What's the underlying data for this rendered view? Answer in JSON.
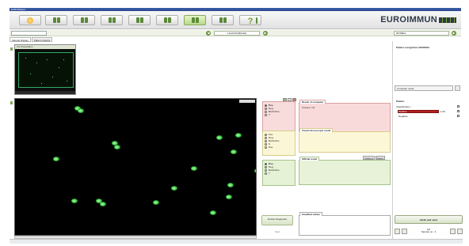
{
  "window": {
    "title": "EUROPattern"
  },
  "toolbar": {
    "brand": "EUROIMMUN"
  },
  "navbar": {
    "sample_id": "13/AFSPCBFADH",
    "right_sample": "0876B0A"
  },
  "tabs": [
    {
      "label": "Sample Display"
    },
    {
      "label": "Pattern Graphs"
    }
  ],
  "overview": {
    "title": "Vis Preparation"
  },
  "image": {
    "zoom": ""
  },
  "options": {
    "computer": [
      "Pos.",
      "Neg.",
      "Borderline",
      "?"
    ],
    "visual": [
      "Pos.",
      "Neg.",
      "Borderline",
      "N",
      "Pos."
    ],
    "official": [
      "Pos.",
      "Neg.",
      "Borderline",
      "?"
    ]
  },
  "panels": {
    "computer": {
      "title": "Result of computer",
      "text": "Positive: 1/0"
    },
    "visual": {
      "title": "Visual microscopic result"
    },
    "official": {
      "title": "Official result",
      "btn_clear": "Cleared",
      "btn_reject": "Reject"
    },
    "unedited": {
      "title": "Unedited values"
    }
  },
  "buttons": {
    "further": "Further Diagnostic",
    "next": "Next",
    "verify": "Verify and send"
  },
  "right": {
    "heading": "Pattern recognition OF/0816A",
    "computer_result": "Computer result",
    "pattern_label": "Pattern",
    "classification": "Classification ...",
    "items": [
      {
        "label": "Positive",
        "value": "1.00",
        "fraction": 1.0
      },
      {
        "label": "Negative",
        "value": "",
        "fraction": 0.0
      }
    ]
  },
  "bottom": {
    "count": "4/4",
    "sample_label": "Sample no.: 4"
  },
  "colors": {
    "accent_green": "#6fa12b",
    "brand_dark": "#2f3a48",
    "computer_red": "#f8dcdc",
    "visual_yellow": "#fbf6d5",
    "official_green": "#e6f2d6",
    "classification_bar": "#b32020"
  }
}
